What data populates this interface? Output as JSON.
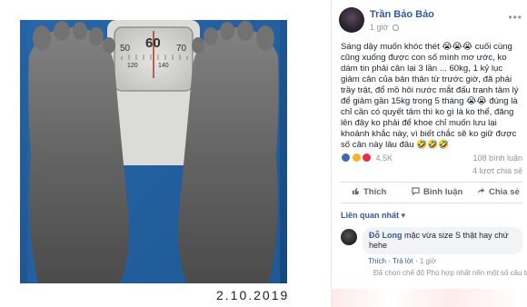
{
  "photo": {
    "date_caption": "2.10.2019",
    "scale_numbers": [
      "50",
      "60",
      "70",
      "120",
      "140"
    ]
  },
  "post": {
    "author": "Trần Bảo Bảo",
    "time": "1 giờ",
    "text": "Sáng dậy muốn khóc thét 😭😭😭 cuối cùng cũng xuống được con số mình mơ ước, ko dám tin phải cân lại 3 lần ... 60kg, 1 kỷ lục giảm cân của bản thân từ trước giờ, đã phải trầy trật, đổ mồ hôi nước mắt đấu tranh tâm lý để giảm gần 15kg trong 5 tháng 😭😭 đúng là chỉ cần có quyết tâm thì ko gì là ko thể, đăng lên đây ko phải để khoe chỉ muốn lưu lại khoảnh khắc này, vì biết chắc sẽ ko giữ được số cân này lâu đâu 🤣🤣🤣",
    "reaction_count": "4,5K",
    "comment_count": "108 bình luận",
    "share_count": "4 lượt chia sẻ",
    "actions": {
      "like": "Thích",
      "comment": "Bình luận",
      "share": "Chia sẻ"
    },
    "filter_label": "Liên quan nhất ▾"
  },
  "comment": {
    "author": "Đỗ Long",
    "text": "mặc vừa size S thật hay chứ hehe",
    "like": "Thích",
    "reply": "Trả lời",
    "time": "1 giờ",
    "reply_preview": "Đã chọn chế độ Phù hợp nhất nên một số câu trả"
  },
  "colors": {
    "link": "#365899",
    "scale_blue": "#1f5fa0",
    "like": "#4267b2",
    "haha": "#f7b125",
    "love": "#f0284a"
  }
}
